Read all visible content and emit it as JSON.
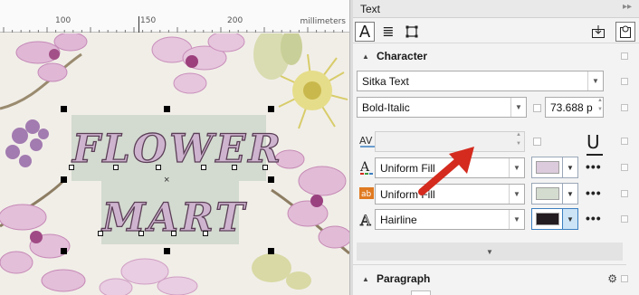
{
  "ruler": {
    "labels": [
      "100",
      "150",
      "200"
    ],
    "unit": "millimeters"
  },
  "artwork": {
    "line1": "FLOWER",
    "line2": "MART",
    "center_mark": "×"
  },
  "panel": {
    "title": "Text",
    "collapse_glyph": "▸▸",
    "toolbar": {
      "character_icon": "A",
      "paragraph_icon": "≣",
      "frame_icon": "⬚",
      "import_icon": "⤓",
      "settings_icon": "⚙"
    },
    "character": {
      "section_title": "Character",
      "font_family": "Sitka Text",
      "font_style": "Bold-Italic",
      "font_size": "73.688 p",
      "kerning_value": "",
      "underline_glyph": "U",
      "fill_rows": [
        {
          "icon": "A",
          "label": "Uniform Fill",
          "swatch": "#dccbdc",
          "focused": false
        },
        {
          "icon": "ab",
          "label": "Uniform Fill",
          "swatch": "#d4dcd0",
          "focused": false
        },
        {
          "icon": "A",
          "label": "Hairline",
          "swatch": "#231c20",
          "focused": true
        }
      ],
      "more_glyph": "•••",
      "expand_glyph": "▼"
    },
    "paragraph": {
      "section_title": "Paragraph",
      "settings_glyph": "⚙"
    }
  },
  "colors": {
    "accent_blue": "#3c7fc1",
    "arrow_red": "#d42b1e",
    "text_fill": "#cfb4d0",
    "text_outline": "#5a3e56",
    "text_background": "#d3dad0"
  }
}
